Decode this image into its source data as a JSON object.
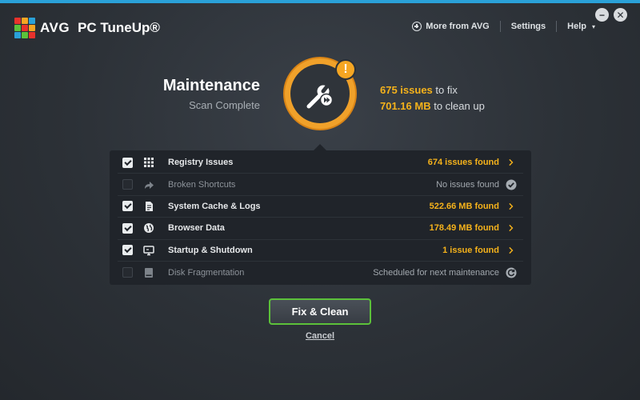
{
  "app": {
    "brand": "AVG",
    "product": "PC TuneUp®",
    "logo_colors": [
      "#e8322c",
      "#f5a623",
      "#2aa1d8",
      "#5cc13a",
      "#e8322c",
      "#f5a623",
      "#2aa1d8",
      "#5cc13a",
      "#e8322c"
    ]
  },
  "nav": {
    "more": "More from AVG",
    "settings": "Settings",
    "help": "Help",
    "help_caret": "▾"
  },
  "window": {
    "minimize": "−",
    "close": "✕"
  },
  "summary": {
    "title": "Maintenance",
    "subtitle": "Scan Complete",
    "issues_value": "675 issues",
    "issues_text": " to fix",
    "cleanup_value": "701.16 MB",
    "cleanup_text": " to clean up",
    "alert": "!",
    "gauge_icon": "wrench-play-icon",
    "accent_color": "#f5a623"
  },
  "items": [
    {
      "label": "Registry Issues",
      "status": "674 issues found",
      "checked": true,
      "enabled": true,
      "icon": "grid-icon",
      "end_icon": "chevron-right-icon"
    },
    {
      "label": "Broken Shortcuts",
      "status": "No issues found",
      "checked": false,
      "enabled": false,
      "icon": "shortcut-arrow-icon",
      "end_icon": "check-circle-icon"
    },
    {
      "label": "System Cache & Logs",
      "status": "522.66 MB found",
      "checked": true,
      "enabled": true,
      "icon": "document-icon",
      "end_icon": "chevron-right-icon"
    },
    {
      "label": "Browser Data",
      "status": "178.49 MB found",
      "checked": true,
      "enabled": true,
      "icon": "globe-icon",
      "end_icon": "chevron-right-icon"
    },
    {
      "label": "Startup & Shutdown",
      "status": "1 issue found",
      "checked": true,
      "enabled": true,
      "icon": "monitor-icon",
      "end_icon": "chevron-right-icon"
    },
    {
      "label": "Disk Fragmentation",
      "status": "Scheduled for next maintenance",
      "checked": false,
      "enabled": false,
      "icon": "disk-icon",
      "end_icon": "schedule-circle-icon"
    }
  ],
  "actions": {
    "fix_clean": "Fix & Clean",
    "cancel": "Cancel"
  }
}
